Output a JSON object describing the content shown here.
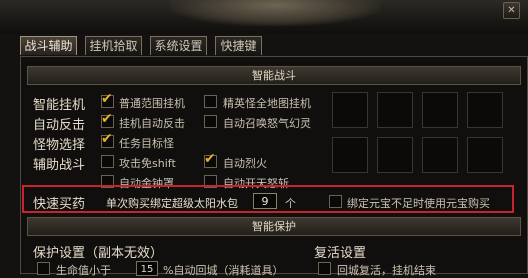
{
  "tabs": [
    "战斗辅助",
    "挂机拾取",
    "系统设置",
    "快捷键"
  ],
  "sections": {
    "smart_combat": "智能战斗",
    "smart_protect": "智能保护"
  },
  "rows": {
    "auto_hang": "智能挂机",
    "auto_counter": "自动反击",
    "monster_select": "怪物选择",
    "assist_combat": "辅助战斗",
    "quick_buy": "快速买药"
  },
  "options": {
    "normal_range_hang": "普通范围挂机",
    "elite_full_map_hang": "精英怪全地图挂机",
    "hang_auto_counter": "挂机自动反击",
    "auto_summon_wrath": "自动召唤怒气幻灵",
    "task_target_monster": "任务目标怪",
    "attack_no_shift": "攻击免shift",
    "auto_fire": "自动烈火",
    "auto_golden_bell": "自动金钟罩",
    "auto_sky_rage": "自动开天怒斩"
  },
  "quick_buy": {
    "text": "单次购买绑定超级太阳水包",
    "quantity": "9",
    "unit": "个",
    "fallback": "绑定元宝不足时使用元宝购买"
  },
  "protect": {
    "title": "保护设置（副本无效）",
    "hp_below": "生命值小于",
    "hp_value": "15",
    "hp_action": "%自动回城（消耗道具）"
  },
  "revive": {
    "title": "复活设置",
    "option": "回城复活，挂机结束"
  },
  "icons": {
    "close": "✕"
  }
}
